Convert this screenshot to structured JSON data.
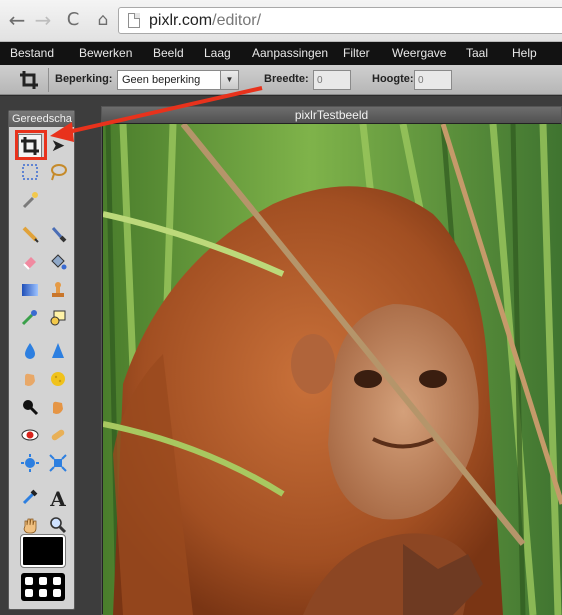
{
  "browser": {
    "url_domain": "pixlr.com",
    "url_path": "/editor/",
    "back_icon": "←",
    "forward_icon": "→",
    "reload_icon": "C",
    "home_icon": "⌂"
  },
  "menu": {
    "items": [
      "Bestand",
      "Bewerken",
      "Beeld",
      "Laag",
      "Aanpassingen",
      "Filter",
      "Weergave",
      "Taal",
      "Help"
    ]
  },
  "options": {
    "constraint_label": "Beperking:",
    "constraint_value": "Geen beperking",
    "width_label": "Breedte:",
    "width_value": "0",
    "height_label": "Hoogte:",
    "height_value": "0"
  },
  "tools": {
    "title": "Gereedscha",
    "items": [
      "crop",
      "move",
      "marquee",
      "lasso",
      "wand",
      "pencil",
      "brush",
      "eraser",
      "bucket",
      "gradient",
      "stamp",
      "replace",
      "drawing",
      "blur",
      "sharpen",
      "smudge",
      "sponge",
      "burn",
      "dodge",
      "redeye",
      "spot-heal",
      "bloat",
      "pinch",
      "picker",
      "type",
      "hand",
      "zoom"
    ],
    "foreground_color": "#000000"
  },
  "image_window": {
    "title": "pixlrTestbeeld"
  },
  "colors": {
    "annotation": "#e8321c"
  }
}
